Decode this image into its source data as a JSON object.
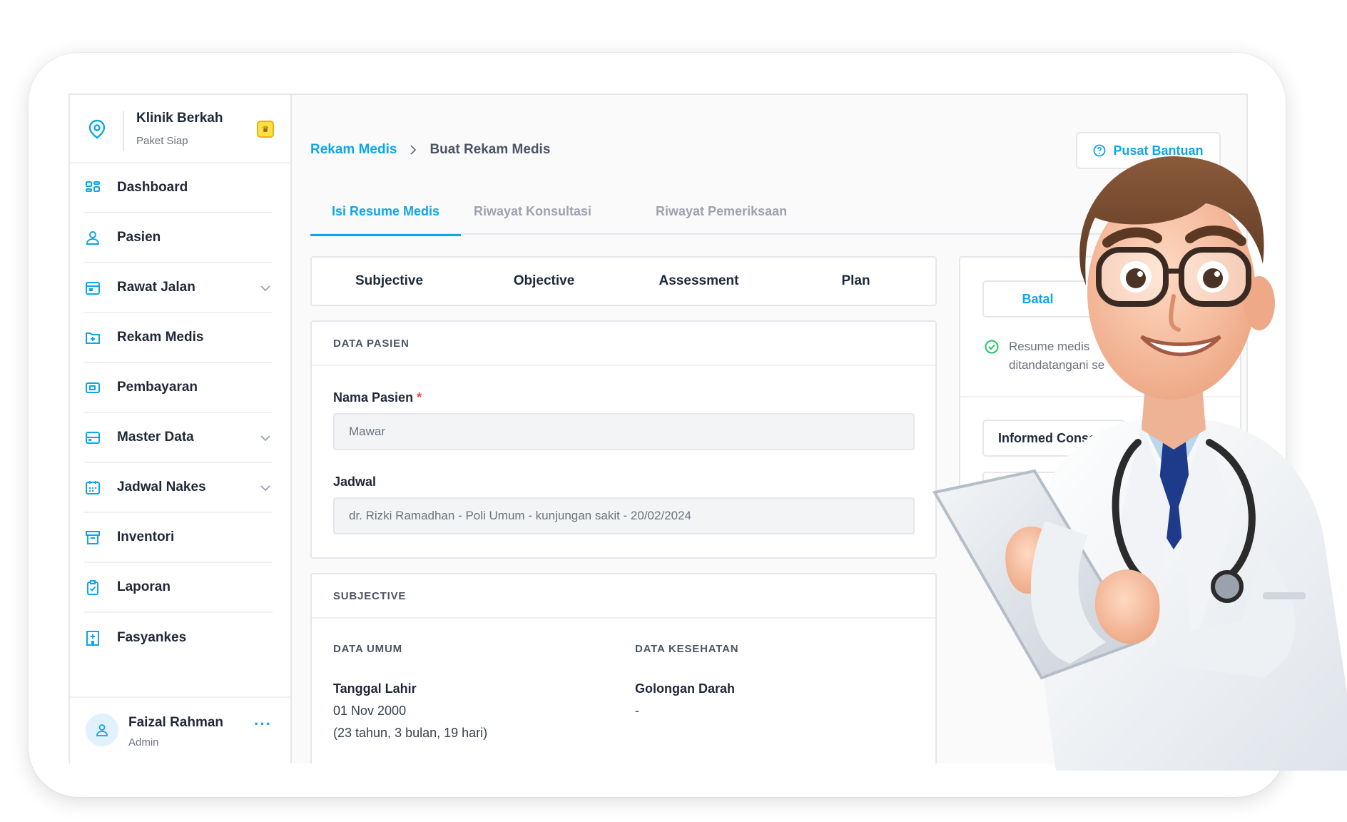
{
  "sidebar": {
    "brand_name": "Klinik Berkah",
    "brand_plan": "Paket Siap",
    "items": [
      {
        "label": "Dashboard",
        "icon": "dashboard-icon",
        "has_children": false
      },
      {
        "label": "Pasien",
        "icon": "user-icon",
        "has_children": false
      },
      {
        "label": "Rawat Jalan",
        "icon": "calendar-icon",
        "has_children": true
      },
      {
        "label": "Rekam Medis",
        "icon": "folder-plus-icon",
        "has_children": false
      },
      {
        "label": "Pembayaran",
        "icon": "payment-icon",
        "has_children": false
      },
      {
        "label": "Master Data",
        "icon": "database-icon",
        "has_children": true
      },
      {
        "label": "Jadwal Nakes",
        "icon": "schedule-icon",
        "has_children": true
      },
      {
        "label": "Inventori",
        "icon": "box-icon",
        "has_children": false
      },
      {
        "label": "Laporan",
        "icon": "clipboard-icon",
        "has_children": false
      },
      {
        "label": "Fasyankes",
        "icon": "hospital-icon",
        "has_children": false
      }
    ],
    "user": {
      "name": "Faizal Rahman",
      "role": "Admin",
      "more": "···"
    }
  },
  "header": {
    "breadcrumb": [
      "Rekam Medis",
      "Buat Rekam Medis"
    ],
    "help_label": "Pusat Bantuan"
  },
  "tabs": [
    "Isi Resume Medis",
    "Riwayat Konsultasi",
    "Riwayat Pemeriksaan"
  ],
  "soap": [
    "Subjective",
    "Objective",
    "Assessment",
    "Plan"
  ],
  "data_pasien": {
    "title": "DATA PASIEN",
    "nama_label": "Nama Pasien",
    "required_mark": "*",
    "nama_value": "Mawar",
    "jadwal_label": "Jadwal",
    "jadwal_value": "dr. Rizki Ramadhan - Poli Umum - kunjungan sakit - 20/02/2024"
  },
  "subjective": {
    "title": "SUBJECTIVE",
    "data_umum": "DATA UMUM",
    "data_kesehatan": "DATA KESEHATAN",
    "tanggal_lahir_label": "Tanggal Lahir",
    "tanggal_lahir_value": "01 Nov 2000",
    "usia_value": "(23 tahun, 3 bulan, 19 hari)",
    "golongan_darah_label": "Golongan Darah",
    "golongan_darah_value": "-"
  },
  "right_panel": {
    "batal_label": "Batal",
    "status_line1": "Resume medis",
    "status_line2": "ditandatangani se",
    "informed_consent_label": "Informed Consent"
  },
  "colors": {
    "accent": "#0ea5e9",
    "success": "#22c55e",
    "required": "#ef4444"
  }
}
